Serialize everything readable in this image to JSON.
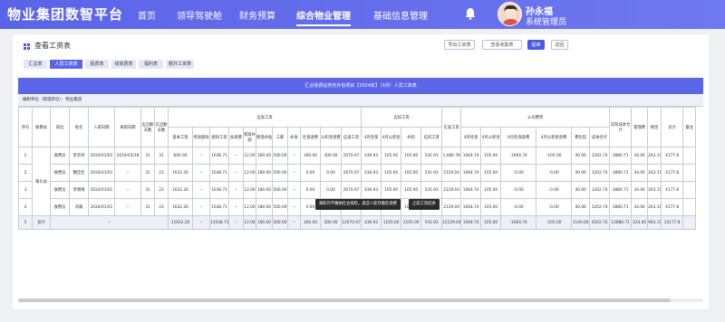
{
  "app": {
    "title": "物业集团数智平台"
  },
  "nav": [
    {
      "label": "首页"
    },
    {
      "label": "领导驾驶舱"
    },
    {
      "label": "财务预算"
    },
    {
      "label": "综合物业管理",
      "active": true
    },
    {
      "label": "基础信息管理"
    }
  ],
  "user": {
    "name": "孙永福",
    "role": "系统管理员"
  },
  "page": {
    "title": "查看工资表"
  },
  "actions": {
    "export_label": "导出工资表",
    "view_attachments_label": "查看考勤表",
    "submit_label": "提审",
    "back_label": "返回"
  },
  "tabs": [
    {
      "label": "汇总表"
    },
    {
      "label": "人员工资表",
      "active": true
    },
    {
      "label": "报费表"
    },
    {
      "label": "绩效费表"
    },
    {
      "label": "福利表"
    },
    {
      "label": "额外工资表"
    }
  ],
  "sheet": {
    "title": "汇合收费站劳务外包项目【2024年】（3月）人员工资表",
    "unit": "编制单位（管理单位）：物业集团"
  },
  "headers": {
    "seq": "序号",
    "fee_station": "收费站",
    "post": "岗位",
    "name": "姓名",
    "join_date": "入职日期",
    "leave_date": "离职日期",
    "due_days": "应出勤天数",
    "actual_days": "实出勤天数",
    "payable_group": "应发工资",
    "deduct_group": "应扣工资",
    "actual_pay": "实发工资",
    "company_group": "公司费用",
    "actual_cost": "实际成本合计",
    "mgmt_fee": "管理费",
    "tax": "税金",
    "total": "总计",
    "remark": "备注",
    "sub": [
      "基本工资",
      "考核绩效",
      "绩效工资",
      "加班费",
      "夜班补助",
      "降温补贴",
      "三薪",
      "补发",
      "社保退费",
      "公积金退费",
      "应发工资",
      "4月社保",
      "4月公积金",
      "补扣",
      "应扣工资",
      "4月社保",
      "4月公积金",
      "4月社保退费",
      "4月公积金退费",
      "费比较",
      "成本合计"
    ]
  },
  "group_label": "莆头站",
  "rows": [
    {
      "seq": "1",
      "post": "收费员",
      "name": "李云祥",
      "join": "2024/01/01",
      "leave": "2024/03/18",
      "due": "31",
      "act": "31",
      "pay": [
        "600.00",
        "--",
        "1038.71",
        "--",
        "12.00",
        "180.00",
        "500.00",
        "--",
        "300.00",
        "300.00",
        "2070.97"
      ],
      "ded": [
        "436.93",
        "105.00",
        "105.00",
        "541.93"
      ],
      "actual": "1,086.78",
      "co": [
        "1064.74",
        "105.00",
        "-1064.74",
        "-105.00",
        "40.00",
        "1202.74"
      ],
      "cost": "3880.71",
      "mgmt": "34.00",
      "tax": "263.11",
      "total": "4177.8",
      "remark": ""
    },
    {
      "seq": "2",
      "post": "收费员",
      "name": "魏佳佳",
      "join": "2024/01/01",
      "leave": "--",
      "due": "31",
      "act": "23",
      "pay": [
        "1632.26",
        "--",
        "1038.71",
        "--",
        "12.00",
        "180.00",
        "500.00",
        "--",
        "0.00",
        "0.00",
        "2670.97"
      ],
      "ded": [
        "436.93",
        "105.00",
        "105.00",
        "541.93"
      ],
      "actual": "2129.04",
      "co": [
        "1064.74",
        "105.00",
        "-0.00",
        "-0.00",
        "40.00",
        "1202.74"
      ],
      "cost": "3880.71",
      "mgmt": "34.00",
      "tax": "263.11",
      "total": "4177.8",
      "remark": ""
    },
    {
      "seq": "3",
      "post": "收费员",
      "name": "李晓晴",
      "join": "2024/01/01",
      "leave": "--",
      "due": "31",
      "act": "23",
      "pay": [
        "1632.26",
        "--",
        "1038.71",
        "--",
        "12.00",
        "180.00",
        "500.00",
        "--",
        "0.00",
        "0.00",
        "2670.97"
      ],
      "ded": [
        "436.93",
        "105.00",
        "105.00",
        "541.93"
      ],
      "actual": "2129.04",
      "co": [
        "1064.74",
        "105.00",
        "-0.00",
        "-0.00",
        "40.00",
        "1202.74"
      ],
      "cost": "3880.71",
      "mgmt": "34.00",
      "tax": "263.11",
      "total": "4177.8",
      "remark": ""
    },
    {
      "seq": "4",
      "post": "收费员",
      "name": "刘森",
      "join": "2024/01/01",
      "leave": "--",
      "due": "31",
      "act": "23",
      "pay": [
        "1632.26",
        "--",
        "1038.71",
        "--",
        "12.00",
        "180.00",
        "500.00",
        "--",
        "0.00",
        "0.00",
        "2670.97"
      ],
      "ded": [
        "436.93",
        "105.00",
        "105.00",
        "541.93"
      ],
      "actual": "2129.04",
      "co": [
        "1064.74",
        "105.00",
        "-0.00",
        "-0.00",
        "40.00",
        "1202.74"
      ],
      "cost": "3880.71",
      "mgmt": "34.00",
      "tax": "263.11",
      "total": "4177.8",
      "remark": ""
    }
  ],
  "total_row": {
    "seq": "5",
    "label": "总计",
    "leave": "--",
    "pay": [
      "11632.26",
      "--",
      "11038.71",
      "--",
      "12.00",
      "180.00",
      "500.00",
      "--",
      "300.00",
      "300.00",
      "12670.97"
    ],
    "ded": [
      "436.93",
      "1105.00",
      "1105.00",
      "541.93"
    ],
    "actual": "12129.04",
    "co": [
      "1064.74",
      "105.00",
      "-1064.74",
      "-105.00",
      "1140.00",
      "4202.74"
    ],
    "cost": "12880.71",
    "mgmt": "224.00",
    "tax": "963.11",
    "total": "14177.8"
  },
  "tooltips": {
    "insurance": "离职月不缴纳社会保险，退还人职月缴社保费",
    "salary": "之前工资结余"
  },
  "colors": {
    "accent": "#5b65e8",
    "topbar": "#5a64e8"
  }
}
